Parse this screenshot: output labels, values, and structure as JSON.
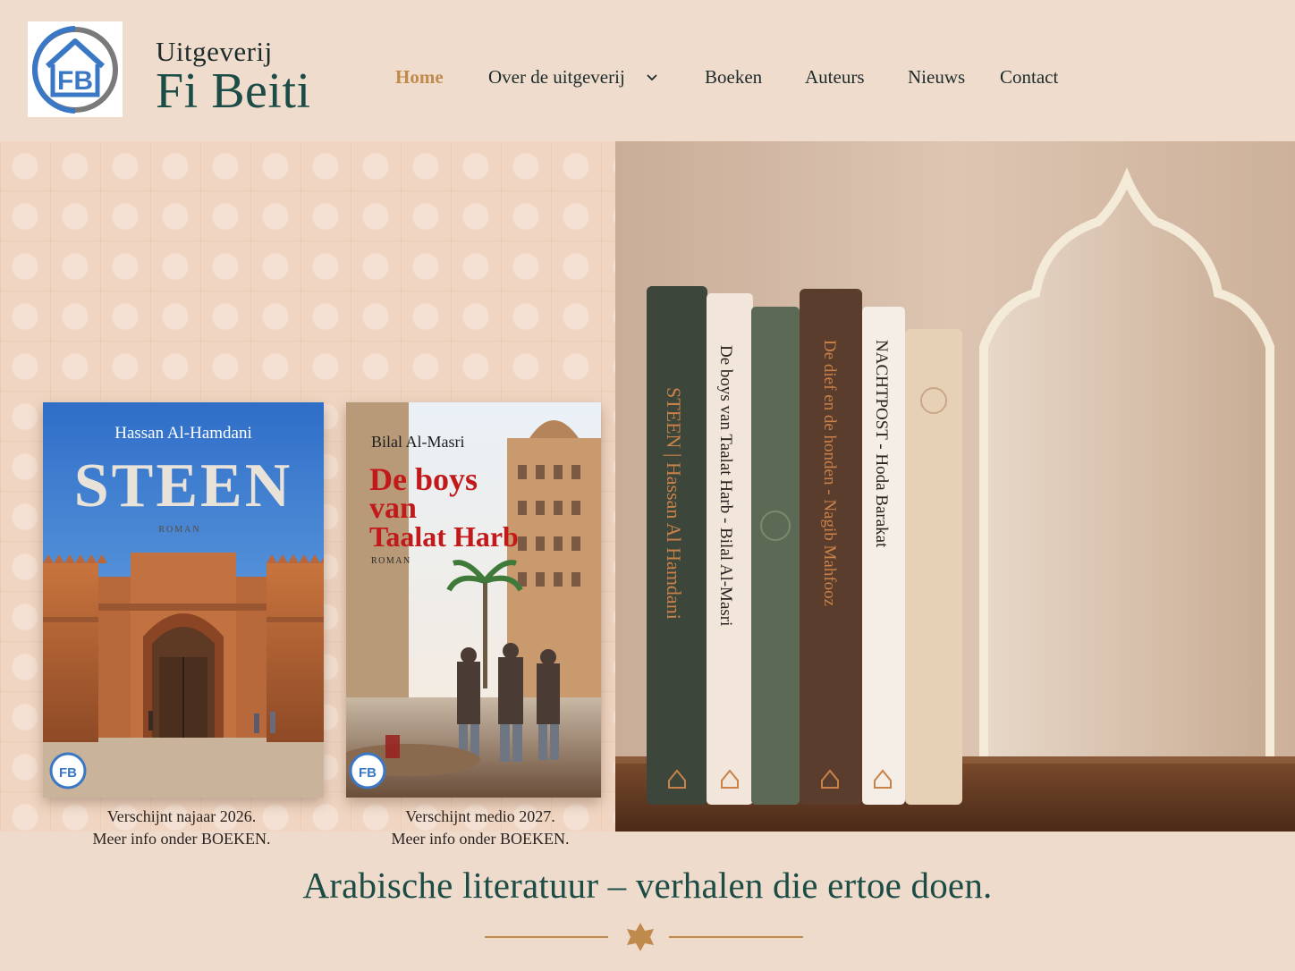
{
  "header": {
    "logo_letters": "FB",
    "brand_small": "Uitgeverij",
    "brand_big": "Fi Beiti"
  },
  "nav": {
    "items": [
      {
        "label": "Home",
        "active": true
      },
      {
        "label": "Over de uitgeverij",
        "has_dropdown": true
      },
      {
        "label": "Boeken"
      },
      {
        "label": "Auteurs"
      },
      {
        "label": "Nieuws"
      },
      {
        "label": "Contact"
      }
    ]
  },
  "covers": [
    {
      "author": "Hassan Al-Hamdani",
      "title": "STEEN",
      "genre": "ROMAN",
      "caption_line1": "Verschijnt najaar 2026.",
      "caption_line2": "Meer info onder BOEKEN."
    },
    {
      "author": "Bilal Al-Masri",
      "title_line1": "De boys",
      "title_line2": "van",
      "title_line3": "Taalat Harb",
      "genre": "ROMAN",
      "caption_line1": "Verschijnt medio 2027.",
      "caption_line2": "Meer info onder BOEKEN."
    }
  ],
  "shelf": {
    "spines": [
      {
        "text": "STEEN  |  Hassan Al Hamdani",
        "color": "#3c463b"
      },
      {
        "text": "De boys van Taalat Harb - Bilal Al-Masri",
        "color": "#f2e6da"
      },
      {
        "text": "",
        "color": "#5c6a55"
      },
      {
        "text": "De dief en de honden - Nagib Mahfooz",
        "color": "#5a3d2c"
      },
      {
        "text": "NACHTPOST - Hoda Barakat",
        "color": "#f4eee6"
      },
      {
        "text": "",
        "color": "#e6d0b6"
      }
    ]
  },
  "tagline": "Arabische literatuur – verhalen die ertoe doen.",
  "colors": {
    "background": "#efdbcc",
    "brand_green": "#1b4c46",
    "accent_gold": "#c08a4c",
    "logo_blue": "#3a78c6"
  }
}
